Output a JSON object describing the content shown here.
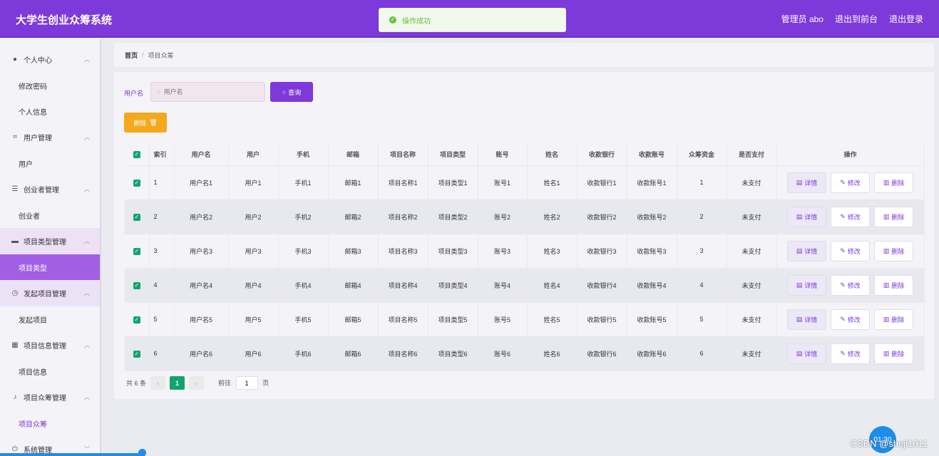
{
  "header": {
    "title": "大学生创业众筹系统",
    "admin": "管理员 abo",
    "to_front": "退出到前台",
    "logout": "退出登录"
  },
  "toast": {
    "message": "操作成功"
  },
  "sidebar": {
    "groups": [
      {
        "label": "个人中心",
        "icon": "user-icon",
        "items": [
          "修改密码",
          "个人信息"
        ]
      },
      {
        "label": "用户管理",
        "icon": "crop-icon",
        "items": [
          "用户"
        ]
      },
      {
        "label": "创业者管理",
        "icon": "list-icon",
        "items": [
          "创业者"
        ]
      },
      {
        "label": "项目类型管理",
        "icon": "monitor-icon",
        "items": [
          "项目类型"
        ]
      },
      {
        "label": "发起项目管理",
        "icon": "clock-icon",
        "items": [
          "发起项目"
        ]
      },
      {
        "label": "项目信息管理",
        "icon": "grid-icon",
        "items": [
          "项目信息"
        ]
      },
      {
        "label": "项目众筹管理",
        "icon": "mic-icon",
        "items": [
          "项目众筹"
        ]
      },
      {
        "label": "系统管理",
        "icon": "power-icon",
        "items": []
      }
    ]
  },
  "breadcrumb": {
    "home": "首页",
    "sep": "/",
    "current": "项目众筹"
  },
  "search": {
    "label": "用户名",
    "placeholder": "用户名",
    "button": "查询"
  },
  "delete_button": "删除",
  "table": {
    "headers": [
      "索引",
      "用户名",
      "用户",
      "手机",
      "邮箱",
      "项目名称",
      "项目类型",
      "账号",
      "姓名",
      "收款银行",
      "收款账号",
      "众筹资金",
      "是否支付",
      "操作"
    ],
    "rows": [
      [
        "1",
        "用户名1",
        "用户1",
        "手机1",
        "邮箱1",
        "项目名称1",
        "项目类型1",
        "账号1",
        "姓名1",
        "收款银行1",
        "收款账号1",
        "1",
        "未支付"
      ],
      [
        "2",
        "用户名2",
        "用户2",
        "手机2",
        "邮箱2",
        "项目名称2",
        "项目类型2",
        "账号2",
        "姓名2",
        "收款银行2",
        "收款账号2",
        "2",
        "未支付"
      ],
      [
        "3",
        "用户名3",
        "用户3",
        "手机3",
        "邮箱3",
        "项目名称3",
        "项目类型3",
        "账号3",
        "姓名3",
        "收款银行3",
        "收款账号3",
        "3",
        "未支付"
      ],
      [
        "4",
        "用户名4",
        "用户4",
        "手机4",
        "邮箱4",
        "项目名称4",
        "项目类型4",
        "账号4",
        "姓名4",
        "收款银行4",
        "收款账号4",
        "4",
        "未支付"
      ],
      [
        "5",
        "用户名5",
        "用户5",
        "手机5",
        "邮箱5",
        "项目名称5",
        "项目类型5",
        "账号5",
        "姓名5",
        "收款银行5",
        "收款账号5",
        "5",
        "未支付"
      ],
      [
        "6",
        "用户名6",
        "用户6",
        "手机6",
        "邮箱6",
        "项目名称6",
        "项目类型6",
        "账号6",
        "姓名6",
        "收款银行6",
        "收款账号6",
        "6",
        "未支付"
      ]
    ],
    "actions": {
      "detail": "详情",
      "edit": "修改",
      "remove": "删除"
    }
  },
  "pager": {
    "total": "共 6 条",
    "current": "1",
    "goto_prefix": "前往",
    "goto_value": "1",
    "goto_suffix": "页"
  },
  "overlay": {
    "timer": "01:30",
    "watermark": "CSDN @sheji1011"
  },
  "colors": {
    "primary": "#7d39d9",
    "success": "#13a36e",
    "warning": "#f4a81b"
  }
}
